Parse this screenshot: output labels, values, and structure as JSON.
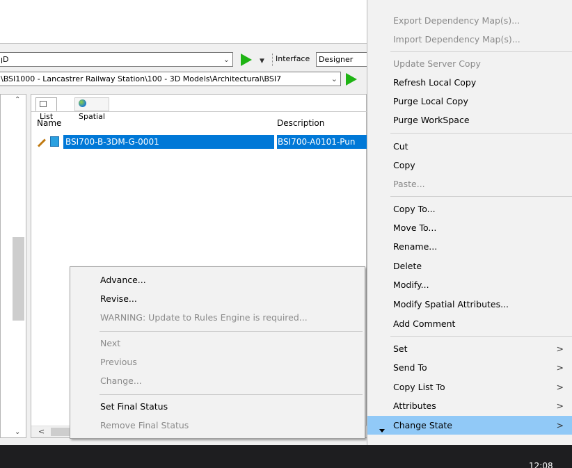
{
  "toolbar": {
    "workspace_combo_value": "ꞁD",
    "interface_label": "Interface",
    "interface_value": "Designer",
    "path_value": "\\BSI1000 - Lancastrer Railway Station\\100 - 3D Models\\Architectural\\BSI7"
  },
  "list_view": {
    "tabs": [
      {
        "label": "List"
      },
      {
        "label": "Spatial"
      }
    ],
    "columns": {
      "name": "Name",
      "description": "Description"
    },
    "rows": [
      {
        "name": "BSI700-B-3DM-G-0001",
        "description": "BSI700-A0101-Pun"
      }
    ]
  },
  "context_menu": {
    "items": [
      {
        "label": "Advance...",
        "enabled": true
      },
      {
        "label": "Revise...",
        "enabled": true
      },
      {
        "label": "WARNING: Update to Rules Engine is required...",
        "enabled": false
      },
      {
        "label": "Next",
        "enabled": false
      },
      {
        "label": "Previous",
        "enabled": false
      },
      {
        "label": "Change...",
        "enabled": false
      },
      {
        "label": "Set Final Status",
        "enabled": true
      },
      {
        "label": "Remove Final Status",
        "enabled": false
      }
    ]
  },
  "main_menu": {
    "items": [
      {
        "label": "Export Dependency Map(s)...",
        "enabled": false
      },
      {
        "label": "Import Dependency Map(s)...",
        "enabled": false
      },
      {
        "label": "Update Server Copy",
        "enabled": false
      },
      {
        "label": "Refresh Local Copy",
        "enabled": true
      },
      {
        "label": "Purge Local Copy",
        "enabled": true
      },
      {
        "label": "Purge WorkSpace",
        "enabled": true
      },
      {
        "label": "Cut",
        "enabled": true
      },
      {
        "label": "Copy",
        "enabled": true
      },
      {
        "label": "Paste...",
        "enabled": false
      },
      {
        "label": "Copy To...",
        "enabled": true
      },
      {
        "label": "Move To...",
        "enabled": true
      },
      {
        "label": "Rename...",
        "enabled": true
      },
      {
        "label": "Delete",
        "enabled": true
      },
      {
        "label": "Modify...",
        "enabled": true
      },
      {
        "label": "Modify Spatial Attributes...",
        "enabled": true
      },
      {
        "label": "Add Comment",
        "enabled": true
      },
      {
        "label": "Set",
        "enabled": true,
        "submenu": true
      },
      {
        "label": "Send To",
        "enabled": true,
        "submenu": true
      },
      {
        "label": "Copy List To",
        "enabled": true,
        "submenu": true
      },
      {
        "label": "Attributes",
        "enabled": true,
        "submenu": true
      },
      {
        "label": "Change State",
        "enabled": true,
        "submenu": true,
        "highlighted": true
      }
    ],
    "submenu_arrow": ">",
    "highlight_color": "#91c9f7"
  },
  "taskbar": {
    "clock": "12:08"
  },
  "icons": {
    "play": "play-icon",
    "chevron": "chevron-down-icon",
    "list": "list-icon",
    "globe": "globe-icon",
    "pencil": "pencil-icon",
    "document": "document-icon"
  },
  "accent_color": "#0078d7"
}
